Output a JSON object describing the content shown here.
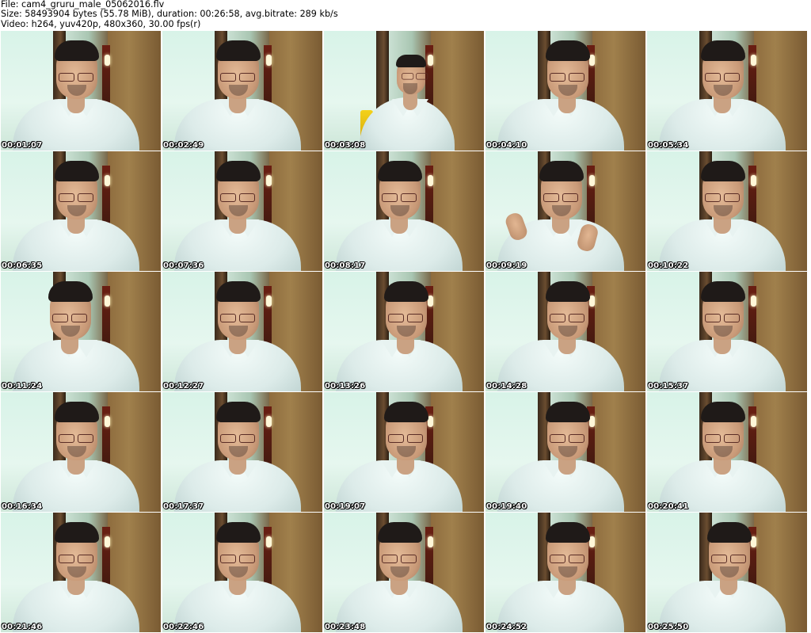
{
  "header": {
    "file_line": "File: cam4_gruru_male_05062016.flv",
    "size_line": "Size: 58493904 bytes (55.78 MiB), duration: 00:26:58, avg.bitrate: 289 kb/s",
    "video_line": "Video: h264, yuv420p, 480x360, 30.00 fps(r)"
  },
  "thumbnails": [
    {
      "timestamp": "00:01:07"
    },
    {
      "timestamp": "00:02:49"
    },
    {
      "timestamp": "00:03:08"
    },
    {
      "timestamp": "00:04:10"
    },
    {
      "timestamp": "00:05:34"
    },
    {
      "timestamp": "00:06:35"
    },
    {
      "timestamp": "00:07:36"
    },
    {
      "timestamp": "00:08:17"
    },
    {
      "timestamp": "00:09:19"
    },
    {
      "timestamp": "00:10:22"
    },
    {
      "timestamp": "00:11:24"
    },
    {
      "timestamp": "00:12:27"
    },
    {
      "timestamp": "00:13:26"
    },
    {
      "timestamp": "00:14:28"
    },
    {
      "timestamp": "00:15:37"
    },
    {
      "timestamp": "00:16:34"
    },
    {
      "timestamp": "00:17:37"
    },
    {
      "timestamp": "00:19:07"
    },
    {
      "timestamp": "00:19:40"
    },
    {
      "timestamp": "00:20:41"
    },
    {
      "timestamp": "00:21:46"
    },
    {
      "timestamp": "00:22:46"
    },
    {
      "timestamp": "00:23:48"
    },
    {
      "timestamp": "00:24:52"
    },
    {
      "timestamp": "00:25:50"
    }
  ]
}
